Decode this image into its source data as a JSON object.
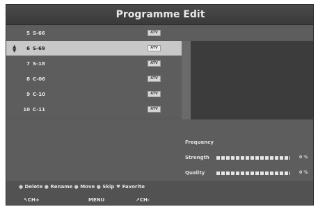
{
  "title": "Programme Edit",
  "channels": [
    {
      "num": "5",
      "name": "S-66",
      "badge": "ATV",
      "selected": false
    },
    {
      "num": "6",
      "name": "S-69",
      "badge": "ATV",
      "selected": true
    },
    {
      "num": "7",
      "name": "S-18",
      "badge": "ATV",
      "selected": false
    },
    {
      "num": "8",
      "name": "C-06",
      "badge": "ATV",
      "selected": false
    },
    {
      "num": "9",
      "name": "C-10",
      "badge": "ATV",
      "selected": false
    },
    {
      "num": "10",
      "name": "C-11",
      "badge": "ATV",
      "selected": false
    }
  ],
  "signal": {
    "frequency_label": "Frequency",
    "strength_label": "Strength",
    "strength_value": "0 %",
    "quality_label": "Quality",
    "quality_value": "0 %"
  },
  "legend": [
    {
      "icon": "red-circle-icon",
      "label": "Delete"
    },
    {
      "icon": "green-circle-icon",
      "label": "Rename"
    },
    {
      "icon": "yellow-circle-icon",
      "label": "Move"
    },
    {
      "icon": "blue-circle-icon",
      "label": "Skip"
    },
    {
      "icon": "heart-icon",
      "label": "Favorite"
    }
  ],
  "keys": {
    "ch_plus": "CH+",
    "menu": "MENU",
    "ch_minus": "CH-"
  }
}
